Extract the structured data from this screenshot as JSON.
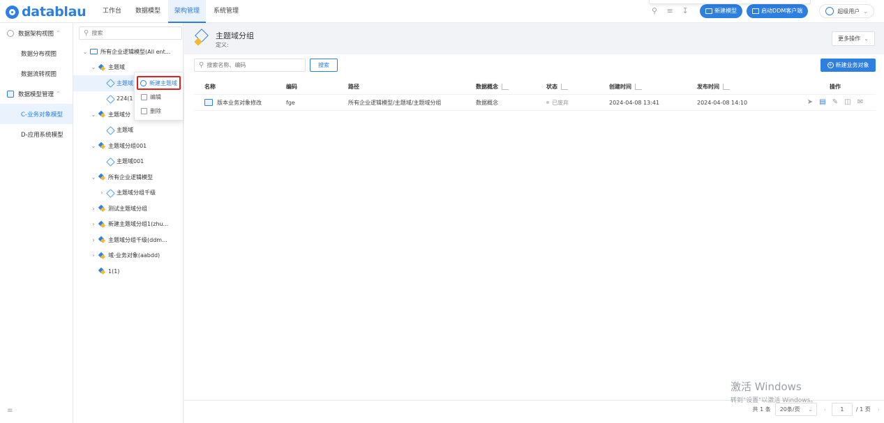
{
  "brand": {
    "name": "datablau",
    "accent": "#2d7fe0"
  },
  "topnav": [
    {
      "label": "工作台",
      "active": false
    },
    {
      "label": "数据模型",
      "active": false
    },
    {
      "label": "架构管理",
      "active": true
    },
    {
      "label": "系统管理",
      "active": false
    }
  ],
  "topright": {
    "icons": [
      "search-icon",
      "layers-icon",
      "download-icon"
    ],
    "new_model": "新建模型",
    "launch_ddm": "启动DDM客户端",
    "user": "超级用户"
  },
  "sidebar": {
    "items": [
      {
        "label": "数据架构视图",
        "icon": "cube-icon",
        "expanded": true
      },
      {
        "label": "数据分布视图",
        "sub": true
      },
      {
        "label": "数据流转视图",
        "sub": true
      },
      {
        "label": "数据模型管理",
        "icon": "model-icon",
        "expanded": true
      },
      {
        "label": "C-业务对象模型",
        "sub": true,
        "active": true
      },
      {
        "label": "D-应用系统模型",
        "sub": true
      }
    ],
    "collapse_icon": "menu-collapse-icon"
  },
  "tree": {
    "search_placeholder": "搜索",
    "nodes": [
      {
        "label": "所有企业逻辑模型(All ent...",
        "level": 0,
        "arrow": "v",
        "icon": "folder"
      },
      {
        "label": "主题域",
        "level": 1,
        "arrow": "v",
        "icon": "group"
      },
      {
        "label": "主题域",
        "level": 2,
        "arrow": "",
        "icon": "domain",
        "selected": true
      },
      {
        "label": "224(1",
        "level": 2,
        "arrow": "",
        "icon": "domain"
      },
      {
        "label": "主题域分",
        "level": 1,
        "arrow": "v",
        "icon": "group"
      },
      {
        "label": "主题域",
        "level": 2,
        "arrow": "",
        "icon": "domain"
      },
      {
        "label": "主题域分组001",
        "level": 1,
        "arrow": "v",
        "icon": "group"
      },
      {
        "label": "主题域001",
        "level": 2,
        "arrow": "",
        "icon": "domain"
      },
      {
        "label": "所有企业逻辑模型",
        "level": 1,
        "arrow": "v",
        "icon": "group"
      },
      {
        "label": "主题域分组千级",
        "level": 2,
        "arrow": ">",
        "icon": "domain"
      },
      {
        "label": "测试主题域分组",
        "level": 1,
        "arrow": ">",
        "icon": "group"
      },
      {
        "label": "新建主题域分组1(zhu...",
        "level": 1,
        "arrow": ">",
        "icon": "group"
      },
      {
        "label": "主题域分组千级(ddm...",
        "level": 1,
        "arrow": ">",
        "icon": "group"
      },
      {
        "label": "域-业务对象(aabdd)",
        "level": 1,
        "arrow": ">",
        "icon": "group"
      },
      {
        "label": "1(1)",
        "level": 1,
        "arrow": "",
        "icon": "group"
      }
    ],
    "context_menu": [
      {
        "label": "新建主题域",
        "icon": "plus-circle-icon",
        "highlight": true
      },
      {
        "label": "编辑",
        "icon": "edit-icon"
      },
      {
        "label": "删除",
        "icon": "trash-icon"
      }
    ]
  },
  "main": {
    "title": "主题域分组",
    "definition": "定义:",
    "more_ops": "更多操作",
    "search_placeholder": "搜索名称、编码",
    "search_btn": "搜索",
    "new_btn": "新建业务对象",
    "columns": {
      "name": "名称",
      "code": "编码",
      "path": "路径",
      "concept": "数据概念",
      "status": "状态",
      "created": "创建时间",
      "published": "发布时间",
      "ops": "操作"
    },
    "rows": [
      {
        "name": "版本业务对象修改",
        "code": "fge",
        "path": "所有企业逻辑模型/主题域/主题域分组",
        "concept": "数据概念",
        "status": "已废弃",
        "created": "2024-04-08 13:41",
        "published": "2024-04-08 14:10",
        "ops": [
          "send-icon",
          "view-icon",
          "edit-icon",
          "delete-icon",
          "mail-icon"
        ]
      }
    ],
    "pager": {
      "total": "共 1 条",
      "page_size": "20条/页",
      "page": "1",
      "pages": "/ 1 页"
    }
  },
  "watermark": {
    "line1": "激活 Windows",
    "line2": "转到\"设置\"以激活 Windows。"
  }
}
